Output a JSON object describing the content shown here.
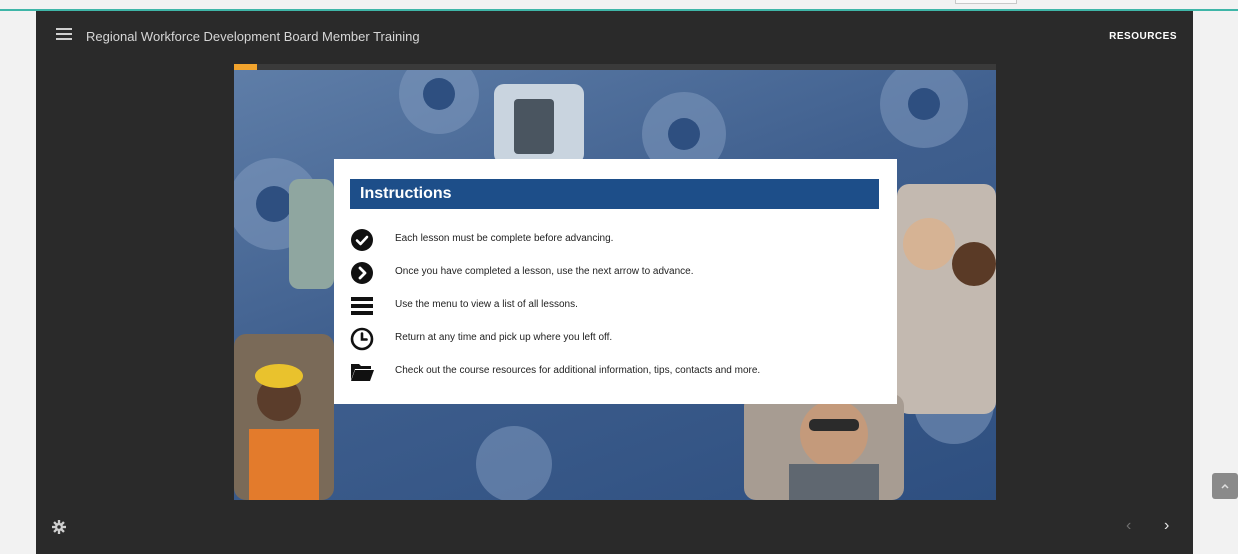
{
  "header": {
    "course_title": "Regional Workforce Development Board Member Training",
    "resources_label": "RESOURCES"
  },
  "slide": {
    "progress_fraction": 0.03,
    "instructions_title": "Instructions",
    "items": [
      {
        "icon": "check-circle-icon",
        "text": "Each lesson must be complete before advancing."
      },
      {
        "icon": "next-arrow-circle-icon",
        "text": "Once you have completed a lesson, use the next arrow to advance."
      },
      {
        "icon": "menu-icon",
        "text": "Use the menu to view a list of all lessons."
      },
      {
        "icon": "clock-icon",
        "text": "Return at any time and pick up where you left off."
      },
      {
        "icon": "folder-icon",
        "text": "Check out the course resources for additional information, tips, contacts and more."
      }
    ]
  },
  "footer": {
    "prev_glyph": "‹",
    "next_glyph": "›"
  },
  "colors": {
    "accent_teal": "#3fb6a8",
    "progress_orange": "#f1a32d",
    "instructions_blue": "#1d4e89",
    "player_bg": "#2a2a2a"
  }
}
